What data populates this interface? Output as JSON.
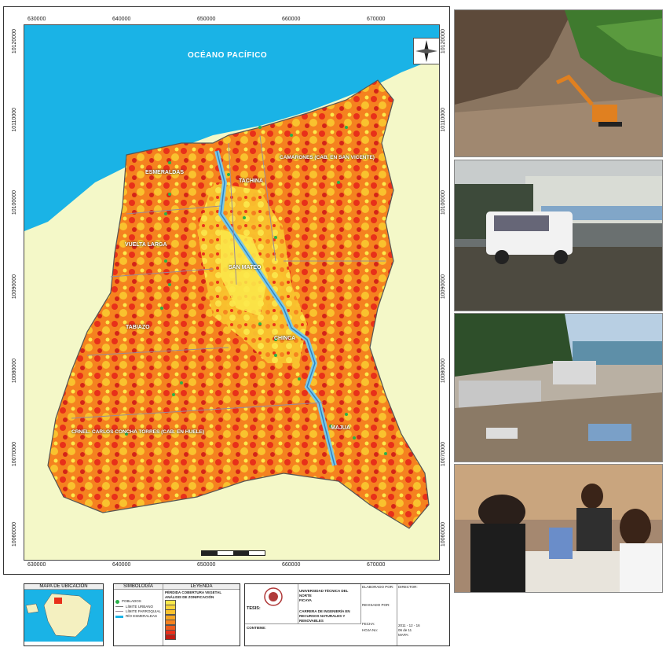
{
  "map": {
    "ocean_label": "OCÉANO PACÍFICO",
    "x_ticks": [
      "630000",
      "640000",
      "650000",
      "660000",
      "670000"
    ],
    "y_ticks": [
      "10120000",
      "10110000",
      "10100000",
      "10090000",
      "10080000",
      "10070000",
      "10060000"
    ],
    "place_labels": [
      {
        "id": "esmeraldas",
        "text": "ESMERALDAS"
      },
      {
        "id": "camarones",
        "text": "CAMARONES (CAB. EN SAN VICENTE)"
      },
      {
        "id": "tachina",
        "text": "TACHINA"
      },
      {
        "id": "vuelta-larga",
        "text": "VUELTA LARGA"
      },
      {
        "id": "san-mateo",
        "text": "SAN MATEO"
      },
      {
        "id": "tabiazo",
        "text": "TABIAZO"
      },
      {
        "id": "chinca",
        "text": "CHINCA"
      },
      {
        "id": "carlos-concha",
        "text": "CRNEL. CARLOS CONCHA TORRES (CAB. EN HUELE)"
      },
      {
        "id": "majua",
        "text": "MAJUA"
      }
    ],
    "colors": {
      "ocean": "#1ab3e6",
      "land_outside": "#f4f8c8",
      "high": "#e8301a",
      "medium": "#f5821f",
      "low": "#f9c22e",
      "verylow": "#fbe94b",
      "river": "#7ec8e3"
    }
  },
  "legend": {
    "location_title": "MAPA DE UBICACIÓN",
    "symbology_title": "SIMBOLOGÍA",
    "symbology_items": [
      "POBLADOS",
      "LÍMITE URBANO",
      "LÍMITE PARROQUIAL",
      "RÍO ESMERALDAS"
    ],
    "legend_title": "LEYENDA",
    "legend_subtitle": "PÉRDIDA COBERTURA VEGETAL",
    "legend_subtitle2": "ANÁLISIS DE ZONIFICACIÓN"
  },
  "title_block": {
    "thesis_label": "TESIS:",
    "university": "UNIVERSIDAD TÉCNICA DEL NORTE",
    "faculty": "FICAYA",
    "career": "CARRERA DE INGENIERÍA EN RECURSOS NATURALES Y RENOVABLES",
    "content_label": "CONTIENE:",
    "prepared_by": "ELABORADO POR:",
    "reviewed_by": "REVISADO POR:",
    "director": "DIRECTOR:",
    "date_label": "FECHA:",
    "date_value": "2011 - 12 - 16",
    "sheet_label": "HOJA No:",
    "sheet_value": "06 de 11",
    "map_label": "MAPA:"
  }
}
